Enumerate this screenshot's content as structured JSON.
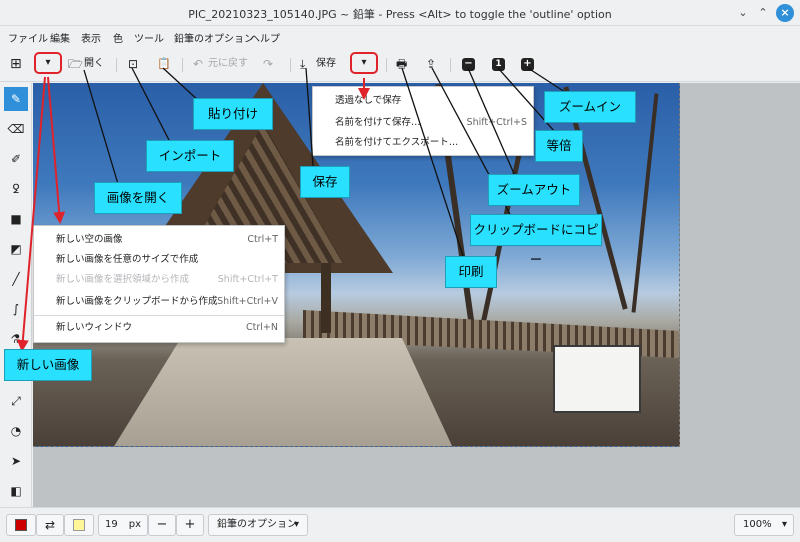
{
  "window": {
    "title": "PIC_20210323_105140.JPG ~ 鉛筆 - Press <Alt> to toggle the 'outline' option"
  },
  "window_controls": {
    "minimize": "⌄",
    "maximize": "⌃",
    "close": "×"
  },
  "menubar": {
    "items": [
      "ファイル",
      "編集",
      "表示",
      "色",
      "ツール",
      "鉛筆のオプション",
      "ヘルプ"
    ]
  },
  "toolbar": {
    "new_icon": "⊞",
    "dropdown": "▾",
    "open_icon": "🗁",
    "open_label": "開く",
    "import_icon": "⊡",
    "paste_icon": "📋",
    "undo_icon": "↶",
    "undo_label": "元に戻す",
    "redo_icon": "↷",
    "save_icon": "⤓",
    "save_label": "保存",
    "save_dropdown": "▾",
    "print_icon": "🖶",
    "export_icon": "⇪",
    "zoom_out_icon": "−",
    "zoom_reset_icon": "1",
    "zoom_in_icon": "+"
  },
  "new_menu": {
    "items": [
      {
        "label": "新しい空の画像",
        "shortcut": "Ctrl+T",
        "enabled": true
      },
      {
        "label": "新しい画像を任意のサイズで作成",
        "shortcut": "",
        "enabled": true
      },
      {
        "label": "新しい画像を選択領域から作成",
        "shortcut": "Shift+Ctrl+T",
        "enabled": false
      },
      {
        "label": "新しい画像をクリップボードから作成",
        "shortcut": "Shift+Ctrl+V",
        "enabled": true
      },
      {
        "label": "新しいウィンドウ",
        "shortcut": "Ctrl+N",
        "enabled": true
      }
    ]
  },
  "save_menu": {
    "items": [
      {
        "label": "透過なしで保存",
        "shortcut": ""
      },
      {
        "label": "名前を付けて保存…",
        "shortcut": "Shift+Ctrl+S"
      },
      {
        "label": "名前を付けてエクスポート…",
        "shortcut": ""
      }
    ]
  },
  "callouts": {
    "new_image": "新しい画像",
    "open_image": "画像を開く",
    "import": "インポート",
    "paste": "貼り付け",
    "save": "保存",
    "print": "印刷",
    "copy_clipboard": "クリップボードにコピー",
    "zoom_out": "ズームアウト",
    "actual_size": "等倍",
    "zoom_in": "ズームイン"
  },
  "sidebar": {
    "tools": [
      "✎",
      "⌫",
      "✐",
      "ꝿ",
      "■",
      "◩",
      "╱",
      "∫",
      "⚗",
      "⤢",
      "◔",
      "➤",
      "◧"
    ]
  },
  "statusbar": {
    "primary_color": "#cc0000",
    "secondary_color": "#fff799",
    "swap_icon": "⇄",
    "size_value": "19",
    "size_unit": "px",
    "minus": "−",
    "plus": "+",
    "options_label": "鉛筆のオプション",
    "zoom_label": "100%"
  },
  "colors": {
    "accent": "#2f8fd8",
    "callout_bg": "#29e1ff",
    "highlight_box": "#e0232a"
  }
}
